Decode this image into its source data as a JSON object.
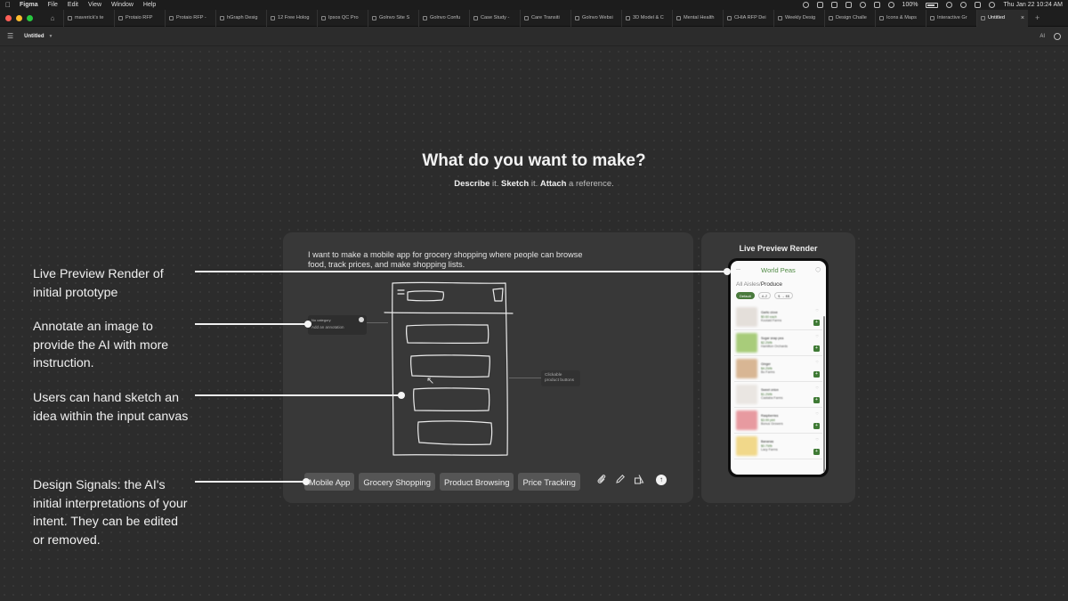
{
  "menubar": {
    "app": "Figma",
    "items": [
      "File",
      "Edit",
      "View",
      "Window",
      "Help"
    ],
    "battery": "100%",
    "datetime": "Thu Jan 22  10:24 AM"
  },
  "tabs": [
    "maverick's te",
    "Protaio RFP",
    "Protaio RFP -",
    "hGraph Desig",
    "12 Free Holog",
    "Ipsos QC Pro",
    "Golnvo Site S",
    "Golnvo Confu",
    "Case Study -",
    "Care Transiti",
    "Golnvo Websi",
    "3D Model & C",
    "Mental Health",
    "CHIA RFP Dei",
    "Weekly Desig",
    "Design Challe",
    "Icons & Maps",
    "Interactive Gr"
  ],
  "active_tab": "Untitled",
  "toolbar": {
    "file_name": "Untitled",
    "ai_label": "AI"
  },
  "hero": {
    "title": "What do you want to make?",
    "sub_describe": "Describe",
    "sub_it1": " it. ",
    "sub_sketch": "Sketch",
    "sub_it2": " it. ",
    "sub_attach": "Attach",
    "sub_rest": " a reference."
  },
  "input": {
    "prompt": "I want to make a mobile app for grocery shopping where people can browse food, track prices, and make shopping lists.",
    "annotation_category": "No category",
    "annotation_placeholder": "Add an annotation",
    "clickable_label": "Clickable product buttons",
    "signals": [
      "Mobile App",
      "Grocery Shopping",
      "Product Browsing",
      "Price Tracking"
    ],
    "tools": [
      "paperclip-icon",
      "pencil-icon",
      "shapes-icon"
    ],
    "send_icon": "arrow-up-icon"
  },
  "preview": {
    "title": "Live Preview Render",
    "app_title": "World Peas",
    "breadcrumb_prefix": "All Aisles/",
    "breadcrumb_current": "Produce",
    "filters": [
      "Default",
      "A-Z",
      "$ → $$"
    ],
    "items": [
      {
        "name": "Garlic clove",
        "price": "$0.60 each",
        "farm": "Koolaid Farms",
        "color": "#e4dfda"
      },
      {
        "name": "Sugar snap pea",
        "price": "$2.29/lb",
        "farm": "Hamilton Orchards",
        "color": "#a8cc7a"
      },
      {
        "name": "Ginger",
        "price": "$4.29/lb",
        "farm": "Bo Farms",
        "color": "#d8b694"
      },
      {
        "name": "Sweet onion",
        "price": "$1.29/lb",
        "farm": "Castaba Farms",
        "color": "#eae6e2"
      },
      {
        "name": "Raspberries",
        "price": "$3.99 pint",
        "farm": "Bonus Growers",
        "color": "#e79aa0"
      },
      {
        "name": "Bananas",
        "price": "$0.79/lb",
        "farm": "Lacy Farms",
        "color": "#f1d88a"
      }
    ]
  },
  "callouts": [
    "Live Preview Render of initial prototype",
    "Annotate an image to provide the AI with more instruction.",
    "Users can hand sketch an idea within the input canvas",
    "Design Signals: the AI's initial interpretations of your intent. They can be edited or removed."
  ],
  "colors": {
    "canvas": "#2c2c2c",
    "panel": "#383838",
    "signal_chip": "#555555",
    "brand_green": "#4a7a3d"
  }
}
